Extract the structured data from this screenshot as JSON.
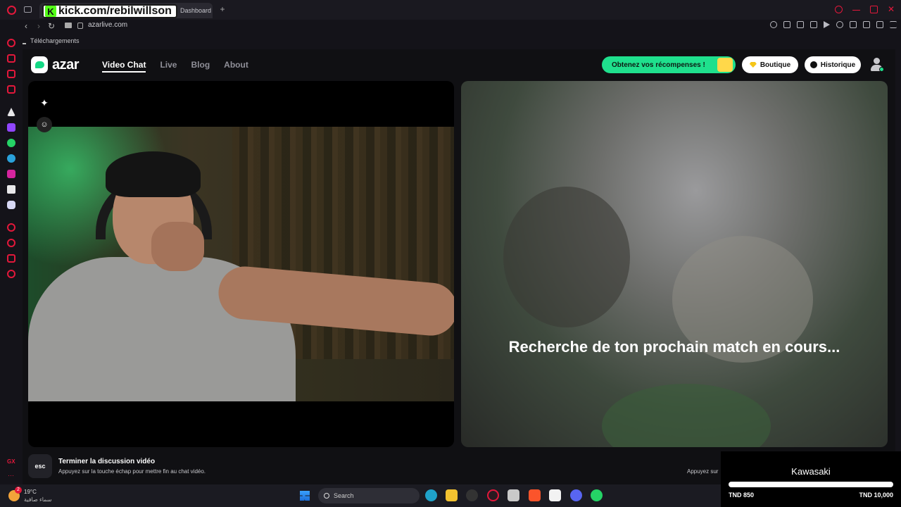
{
  "browser": {
    "tab_title": "Dashboard",
    "watermark": "kick.com/rebilwillson",
    "url": "azarlive.com",
    "bookmark_downloads": "Téléchargements"
  },
  "nav": {
    "logo": "azar",
    "links": [
      "Video Chat",
      "Live",
      "Blog",
      "About"
    ],
    "active": "Video Chat",
    "rewards": "Obtenez vos récompenses !",
    "shop": "Boutique",
    "history": "Historique"
  },
  "video": {
    "searching": "Recherche de ton prochain match en cours..."
  },
  "footer": {
    "esc": "esc",
    "end_title": "Terminer la discussion vidéo",
    "end_sub": "Appuyez sur la touche échap pour mettre fin au chat vidéo.",
    "hint_right": "Appuyez sur"
  },
  "sidebar": {
    "bottom_label": "GX"
  },
  "taskbar": {
    "weather_badge": "2",
    "temp": "19°C",
    "condition": "سماء صافية",
    "search": "Search"
  },
  "overlay": {
    "title": "Kawasaki",
    "min": "TND 850",
    "max": "TND 10,000",
    "progress": 0
  },
  "colors": {
    "accent": "#1fe08d",
    "opera_red": "#e3183b"
  }
}
